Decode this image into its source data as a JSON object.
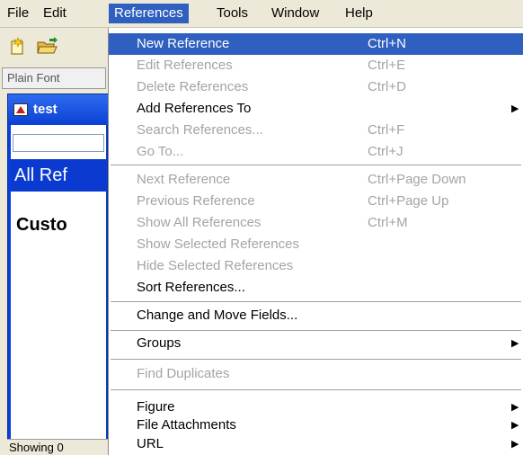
{
  "menubar": {
    "items": [
      "File",
      "Edit",
      "References",
      "Tools",
      "Window",
      "Help"
    ],
    "active": "References"
  },
  "toolbar": {
    "font_field": "Plain Font",
    "icons": [
      "new-document-icon",
      "open-folder-icon"
    ]
  },
  "document_window": {
    "title": "test",
    "all_refs": "All Ref",
    "custom_label": "Custo",
    "status": "Showing 0"
  },
  "references_menu": {
    "items": [
      {
        "label": "New Reference",
        "shortcut": "Ctrl+N",
        "enabled": true,
        "highlighted": true
      },
      {
        "label": "Edit References",
        "shortcut": "Ctrl+E",
        "enabled": false
      },
      {
        "label": "Delete References",
        "shortcut": "Ctrl+D",
        "enabled": false
      },
      {
        "label": "Add References To",
        "shortcut": "",
        "enabled": true,
        "submenu": true
      },
      {
        "label": "Search References...",
        "shortcut": "Ctrl+F",
        "enabled": false
      },
      {
        "label": "Go To...",
        "shortcut": "Ctrl+J",
        "enabled": false
      },
      {
        "label": "Next Reference",
        "shortcut": "Ctrl+Page Down",
        "enabled": false
      },
      {
        "label": "Previous Reference",
        "shortcut": "Ctrl+Page Up",
        "enabled": false
      },
      {
        "label": "Show All References",
        "shortcut": "Ctrl+M",
        "enabled": false
      },
      {
        "label": "Show Selected References",
        "shortcut": "",
        "enabled": false
      },
      {
        "label": "Hide Selected References",
        "shortcut": "",
        "enabled": false
      },
      {
        "label": "Sort References...",
        "shortcut": "",
        "enabled": true
      },
      {
        "label": "Change and Move Fields...",
        "shortcut": "",
        "enabled": true
      },
      {
        "label": "Groups",
        "shortcut": "",
        "enabled": true,
        "submenu": true
      },
      {
        "label": "Find Duplicates",
        "shortcut": "",
        "enabled": false
      },
      {
        "label": "Figure",
        "shortcut": "",
        "enabled": true,
        "submenu": true
      },
      {
        "label": "File Attachments",
        "shortcut": "",
        "enabled": true,
        "submenu": true
      },
      {
        "label": "URL",
        "shortcut": "",
        "enabled": true,
        "submenu": true
      }
    ]
  },
  "colors": {
    "highlight": "#2f5fbf",
    "menubar_bg": "#ece9d8",
    "disabled_text": "#a4a4a4"
  }
}
